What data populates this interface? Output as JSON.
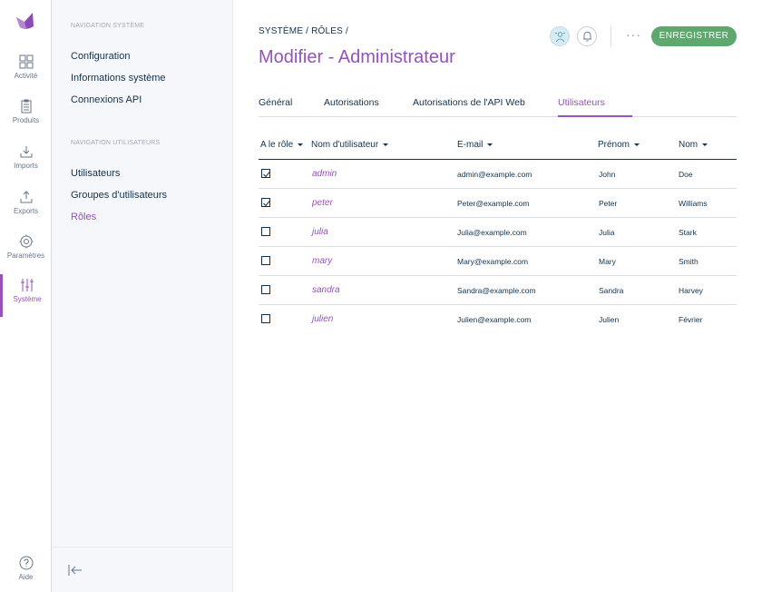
{
  "rail": {
    "items": [
      {
        "label": "Activité",
        "icon": "dashboard-icon"
      },
      {
        "label": "Produits",
        "icon": "products-icon"
      },
      {
        "label": "Imports",
        "icon": "import-icon"
      },
      {
        "label": "Exports",
        "icon": "export-icon"
      },
      {
        "label": "Paramètres",
        "icon": "settings-icon"
      },
      {
        "label": "Système",
        "icon": "system-sliders-icon",
        "active": true
      }
    ],
    "help_label": "Aide"
  },
  "subnav": {
    "system_title": "NAVIGATION SYSTÈME",
    "system_links": [
      "Configuration",
      "Informations système",
      "Connexions API"
    ],
    "users_title": "NAVIGATION UTILISATEURS",
    "users_links": [
      "Utilisateurs",
      "Groupes d'utilisateurs",
      "Rôles"
    ],
    "active_link": "Rôles"
  },
  "header": {
    "breadcrumb": "SYSTÈME / RÔLES /",
    "title": "Modifier - Administrateur",
    "save_label": "ENREGISTRER",
    "more_label": "···"
  },
  "tabs": [
    {
      "label": "Général"
    },
    {
      "label": "Autorisations"
    },
    {
      "label": "Autorisations de l'API Web"
    },
    {
      "label": "Utilisateurs",
      "active": true
    }
  ],
  "table": {
    "columns": [
      "A le rôle",
      "Nom d'utilisateur",
      "E-mail",
      "Prénom",
      "Nom"
    ],
    "rows": [
      {
        "has_role": true,
        "username": "admin",
        "email": "admin@example.com",
        "first": "John",
        "last": "Doe"
      },
      {
        "has_role": true,
        "username": "peter",
        "email": "Peter@example.com",
        "first": "Peter",
        "last": "Williams"
      },
      {
        "has_role": false,
        "username": "julia",
        "email": "Julia@example.com",
        "first": "Julia",
        "last": "Stark"
      },
      {
        "has_role": false,
        "username": "mary",
        "email": "Mary@example.com",
        "first": "Mary",
        "last": "Smith"
      },
      {
        "has_role": false,
        "username": "sandra",
        "email": "Sandra@example.com",
        "first": "Sandra",
        "last": "Harvey"
      },
      {
        "has_role": false,
        "username": "julien",
        "email": "Julien@example.com",
        "first": "Julien",
        "last": "Février"
      }
    ]
  },
  "colors": {
    "accent": "#9452ba",
    "text": "#11324d",
    "save": "#5ea86d"
  }
}
